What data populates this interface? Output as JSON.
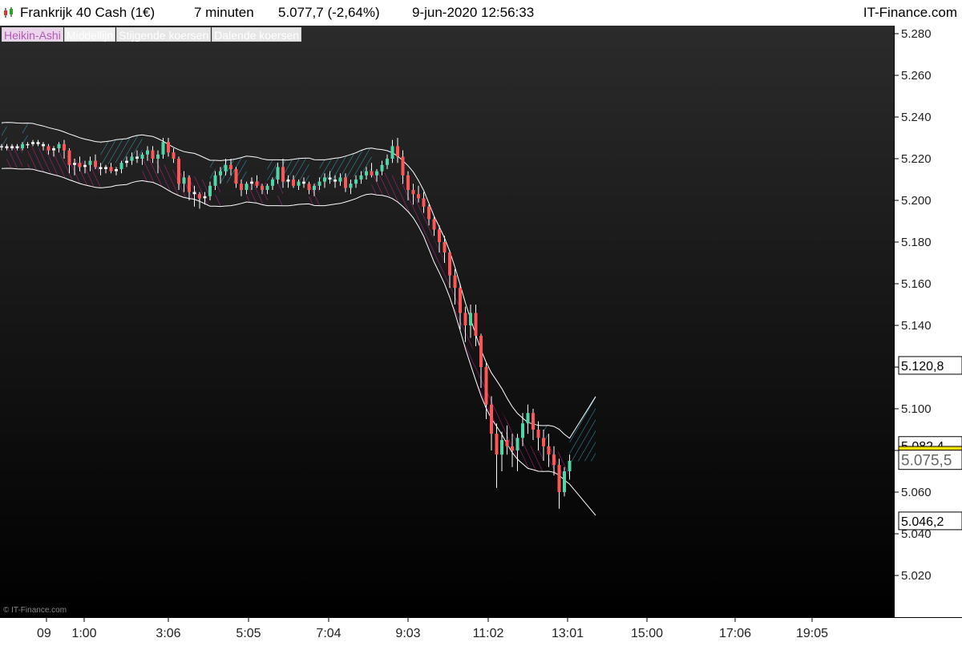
{
  "header": {
    "instrument": "Frankrijk 40 Cash (1€)",
    "interval": "7 minuten",
    "quote": "5.077,7 (-2,64%)",
    "datetime": "9-jun-2020 12:56:33",
    "brand": "IT-Finance.com"
  },
  "legend": [
    "Heikin-Ashi",
    "Middellijn",
    "Stijgende koersen",
    "Dalende koersen"
  ],
  "watermark": "© IT-Finance.com",
  "colors": {
    "up_candle": "#4fd6a6",
    "down_candle": "#ff5555",
    "neutral_candle": "#f0f0f0",
    "band_line": "#ffffff",
    "rising_hatch": "#33aacc",
    "falling_hatch": "#cc2299",
    "middle_hatch": "#e6e600",
    "quote_marker": "#f4e000"
  },
  "chart_data": {
    "type": "candlestick",
    "y_ticks": [
      "5.280",
      "5.260",
      "5.240",
      "5.220",
      "5.200",
      "5.180",
      "5.160",
      "5.140",
      "5.120",
      "5.100",
      "5.080",
      "5.060",
      "5.040",
      "5.020"
    ],
    "x_ticks": [
      "09",
      "1:00",
      "3:06",
      "5:05",
      "7:04",
      "9:03",
      "11:02",
      "13:01",
      "15:00",
      "17:06",
      "19:05"
    ],
    "ylim": [
      5005,
      5290
    ],
    "markers": [
      {
        "label": "5.120,8",
        "value": 5120.8
      },
      {
        "label": "5.082,4",
        "value": 5082.4
      },
      {
        "label": "5.077,7",
        "value": 5077.7,
        "style": "quote"
      },
      {
        "label": "5.075,5",
        "value": 5075.5,
        "style": "large"
      },
      {
        "label": "5.046,2",
        "value": 5046.2
      }
    ],
    "candles": [
      [
        5226,
        5227,
        5224,
        5226
      ],
      [
        5226,
        5227,
        5224,
        5225
      ],
      [
        5225,
        5227,
        5224,
        5226
      ],
      [
        5226,
        5227,
        5224,
        5225
      ],
      [
        5225,
        5228,
        5224,
        5227
      ],
      [
        5227,
        5228,
        5225,
        5227
      ],
      [
        5227,
        5229,
        5226,
        5228
      ],
      [
        5228,
        5229,
        5226,
        5227
      ],
      [
        5227,
        5228,
        5224,
        5226
      ],
      [
        5226,
        5227,
        5222,
        5224
      ],
      [
        5224,
        5226,
        5221,
        5225
      ],
      [
        5225,
        5228,
        5223,
        5227
      ],
      [
        5227,
        5229,
        5220,
        5224
      ],
      [
        5224,
        5225,
        5213,
        5217
      ],
      [
        5217,
        5220,
        5212,
        5218
      ],
      [
        5218,
        5221,
        5214,
        5216
      ],
      [
        5216,
        5219,
        5213,
        5217
      ],
      [
        5217,
        5221,
        5214,
        5219
      ],
      [
        5219,
        5222,
        5215,
        5216
      ],
      [
        5216,
        5218,
        5212,
        5215
      ],
      [
        5215,
        5217,
        5213,
        5216
      ],
      [
        5216,
        5218,
        5213,
        5214
      ],
      [
        5214,
        5216,
        5212,
        5215
      ],
      [
        5215,
        5219,
        5213,
        5218
      ],
      [
        5218,
        5221,
        5216,
        5219
      ],
      [
        5219,
        5223,
        5217,
        5221
      ],
      [
        5221,
        5224,
        5218,
        5220
      ],
      [
        5220,
        5223,
        5217,
        5222
      ],
      [
        5222,
        5226,
        5219,
        5224
      ],
      [
        5224,
        5226,
        5218,
        5220
      ],
      [
        5220,
        5224,
        5213,
        5222
      ],
      [
        5222,
        5230,
        5220,
        5228
      ],
      [
        5228,
        5230,
        5221,
        5223
      ],
      [
        5223,
        5225,
        5218,
        5220
      ],
      [
        5220,
        5221,
        5205,
        5208
      ],
      [
        5208,
        5214,
        5204,
        5211
      ],
      [
        5211,
        5212,
        5200,
        5204
      ],
      [
        5204,
        5207,
        5197,
        5203
      ],
      [
        5203,
        5204,
        5196,
        5201
      ],
      [
        5201,
        5204,
        5198,
        5202
      ],
      [
        5202,
        5209,
        5200,
        5207
      ],
      [
        5207,
        5214,
        5205,
        5212
      ],
      [
        5212,
        5216,
        5208,
        5214
      ],
      [
        5214,
        5220,
        5212,
        5217
      ],
      [
        5217,
        5220,
        5212,
        5215
      ],
      [
        5215,
        5216,
        5206,
        5208
      ],
      [
        5208,
        5210,
        5202,
        5205
      ],
      [
        5205,
        5209,
        5203,
        5208
      ],
      [
        5208,
        5211,
        5205,
        5209
      ],
      [
        5209,
        5212,
        5206,
        5207
      ],
      [
        5207,
        5208,
        5203,
        5205
      ],
      [
        5205,
        5208,
        5203,
        5207
      ],
      [
        5207,
        5211,
        5205,
        5210
      ],
      [
        5210,
        5218,
        5208,
        5216
      ],
      [
        5216,
        5220,
        5206,
        5209
      ],
      [
        5209,
        5212,
        5206,
        5210
      ],
      [
        5210,
        5212,
        5206,
        5207
      ],
      [
        5207,
        5210,
        5205,
        5209
      ],
      [
        5209,
        5211,
        5206,
        5208
      ],
      [
        5208,
        5209,
        5203,
        5205
      ],
      [
        5205,
        5208,
        5202,
        5207
      ],
      [
        5207,
        5211,
        5205,
        5209
      ],
      [
        5209,
        5213,
        5206,
        5211
      ],
      [
        5211,
        5214,
        5208,
        5210
      ],
      [
        5210,
        5212,
        5206,
        5209
      ],
      [
        5209,
        5213,
        5207,
        5211
      ],
      [
        5211,
        5213,
        5204,
        5206
      ],
      [
        5206,
        5210,
        5203,
        5208
      ],
      [
        5208,
        5212,
        5206,
        5210
      ],
      [
        5210,
        5214,
        5208,
        5212
      ],
      [
        5212,
        5216,
        5210,
        5214
      ],
      [
        5214,
        5218,
        5211,
        5212
      ],
      [
        5212,
        5215,
        5209,
        5214
      ],
      [
        5214,
        5219,
        5212,
        5217
      ],
      [
        5217,
        5222,
        5215,
        5220
      ],
      [
        5220,
        5229,
        5218,
        5226
      ],
      [
        5226,
        5230,
        5218,
        5221
      ],
      [
        5221,
        5224,
        5208,
        5212
      ],
      [
        5212,
        5214,
        5200,
        5205
      ],
      [
        5205,
        5208,
        5198,
        5203
      ],
      [
        5203,
        5207,
        5199,
        5201
      ],
      [
        5201,
        5204,
        5194,
        5197
      ],
      [
        5197,
        5198,
        5188,
        5191
      ],
      [
        5191,
        5192,
        5183,
        5186
      ],
      [
        5186,
        5188,
        5175,
        5180
      ],
      [
        5180,
        5183,
        5170,
        5175
      ],
      [
        5175,
        5176,
        5158,
        5164
      ],
      [
        5164,
        5167,
        5150,
        5158
      ],
      [
        5158,
        5160,
        5138,
        5146
      ],
      [
        5146,
        5149,
        5132,
        5140
      ],
      [
        5140,
        5150,
        5134,
        5146
      ],
      [
        5146,
        5150,
        5130,
        5135
      ],
      [
        5135,
        5136,
        5110,
        5120
      ],
      [
        5120,
        5122,
        5095,
        5102
      ],
      [
        5102,
        5106,
        5080,
        5088
      ],
      [
        5088,
        5093,
        5062,
        5078
      ],
      [
        5078,
        5089,
        5070,
        5085
      ],
      [
        5085,
        5092,
        5078,
        5082
      ],
      [
        5082,
        5088,
        5072,
        5080
      ],
      [
        5080,
        5088,
        5070,
        5086
      ],
      [
        5086,
        5098,
        5082,
        5093
      ],
      [
        5093,
        5102,
        5088,
        5098
      ],
      [
        5098,
        5100,
        5085,
        5090
      ],
      [
        5090,
        5094,
        5080,
        5086
      ],
      [
        5086,
        5090,
        5075,
        5082
      ],
      [
        5082,
        5088,
        5072,
        5078
      ],
      [
        5078,
        5082,
        5068,
        5073
      ],
      [
        5073,
        5076,
        5052,
        5060
      ],
      [
        5060,
        5072,
        5058,
        5070
      ],
      [
        5070,
        5078,
        5066,
        5075
      ]
    ]
  }
}
